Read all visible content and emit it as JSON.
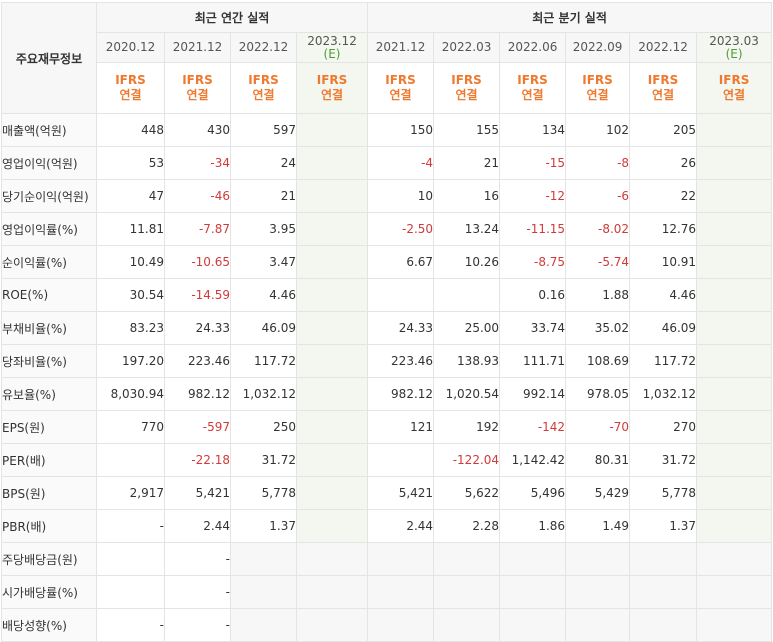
{
  "table": {
    "corner_label": "주요재무정보",
    "annual_header": "최근 연간 실적",
    "quarter_header": "최근 분기 실적",
    "columns": [
      {
        "date": "2020.12",
        "est": "",
        "ifrs": "IFRS",
        "basis": "연결"
      },
      {
        "date": "2021.12",
        "est": "",
        "ifrs": "IFRS",
        "basis": "연결"
      },
      {
        "date": "2022.12",
        "est": "",
        "ifrs": "IFRS",
        "basis": "연결"
      },
      {
        "date": "2023.12",
        "est": "(E)",
        "ifrs": "IFRS",
        "basis": "연결"
      },
      {
        "date": "2021.12",
        "est": "",
        "ifrs": "IFRS",
        "basis": "연결"
      },
      {
        "date": "2022.03",
        "est": "",
        "ifrs": "IFRS",
        "basis": "연결"
      },
      {
        "date": "2022.06",
        "est": "",
        "ifrs": "IFRS",
        "basis": "연결"
      },
      {
        "date": "2022.09",
        "est": "",
        "ifrs": "IFRS",
        "basis": "연결"
      },
      {
        "date": "2022.12",
        "est": "",
        "ifrs": "IFRS",
        "basis": "연결"
      },
      {
        "date": "2023.03",
        "est": "(E)",
        "ifrs": "IFRS",
        "basis": "연결"
      }
    ],
    "rows": [
      {
        "label": "매출액(억원)",
        "values": [
          "448",
          "430",
          "597",
          "",
          "150",
          "155",
          "134",
          "102",
          "205",
          ""
        ]
      },
      {
        "label": "영업이익(억원)",
        "values": [
          "53",
          "-34",
          "24",
          "",
          "-4",
          "21",
          "-15",
          "-8",
          "26",
          ""
        ]
      },
      {
        "label": "당기순이익(억원)",
        "values": [
          "47",
          "-46",
          "21",
          "",
          "10",
          "16",
          "-12",
          "-6",
          "22",
          ""
        ]
      },
      {
        "label": "영업이익률(%)",
        "values": [
          "11.81",
          "-7.87",
          "3.95",
          "",
          "-2.50",
          "13.24",
          "-11.15",
          "-8.02",
          "12.76",
          ""
        ]
      },
      {
        "label": "순이익률(%)",
        "values": [
          "10.49",
          "-10.65",
          "3.47",
          "",
          "6.67",
          "10.26",
          "-8.75",
          "-5.74",
          "10.91",
          ""
        ]
      },
      {
        "label": "ROE(%)",
        "values": [
          "30.54",
          "-14.59",
          "4.46",
          "",
          "",
          "",
          "0.16",
          "1.88",
          "4.46",
          ""
        ]
      },
      {
        "label": "부채비율(%)",
        "values": [
          "83.23",
          "24.33",
          "46.09",
          "",
          "24.33",
          "25.00",
          "33.74",
          "35.02",
          "46.09",
          ""
        ]
      },
      {
        "label": "당좌비율(%)",
        "values": [
          "197.20",
          "223.46",
          "117.72",
          "",
          "223.46",
          "138.93",
          "111.71",
          "108.69",
          "117.72",
          ""
        ]
      },
      {
        "label": "유보율(%)",
        "values": [
          "8,030.94",
          "982.12",
          "1,032.12",
          "",
          "982.12",
          "1,020.54",
          "992.14",
          "978.05",
          "1,032.12",
          ""
        ]
      },
      {
        "label": "EPS(원)",
        "values": [
          "770",
          "-597",
          "250",
          "",
          "121",
          "192",
          "-142",
          "-70",
          "270",
          ""
        ]
      },
      {
        "label": "PER(배)",
        "values": [
          "",
          "-22.18",
          "31.72",
          "",
          "",
          "-122.04",
          "1,142.42",
          "80.31",
          "31.72",
          ""
        ]
      },
      {
        "label": "BPS(원)",
        "values": [
          "2,917",
          "5,421",
          "5,778",
          "",
          "5,421",
          "5,622",
          "5,496",
          "5,429",
          "5,778",
          ""
        ]
      },
      {
        "label": "PBR(배)",
        "values": [
          "-",
          "2.44",
          "1.37",
          "",
          "2.44",
          "2.28",
          "1.86",
          "1.49",
          "1.37",
          ""
        ]
      },
      {
        "label": "주당배당금(원)",
        "values": [
          "",
          "-",
          "",
          "",
          "",
          "",
          "",
          "",
          "",
          ""
        ]
      },
      {
        "label": "시가배당률(%)",
        "values": [
          "",
          "-",
          "",
          "",
          "",
          "",
          "",
          "",
          "",
          ""
        ]
      },
      {
        "label": "배당성향(%)",
        "values": [
          "-",
          "-",
          "",
          "",
          "",
          "",
          "",
          "",
          "",
          ""
        ]
      }
    ],
    "colors": {
      "negative": "#d23a3a",
      "ifrs": "#ee7a30",
      "estimate": "#4f9c3a"
    }
  }
}
